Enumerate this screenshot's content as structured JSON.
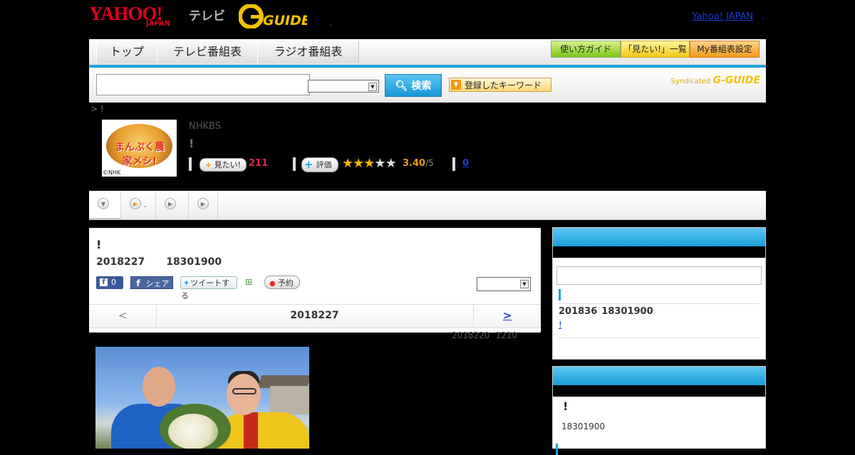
{
  "header": {
    "logo_yahoo": "YAHOO!",
    "logo_japan": "JAPAN",
    "logo_tv": "テレビ",
    "logo_gguide": "G-GUIDE",
    "separator_dot": ".",
    "yahoo_japan_link": "Yahoo! JAPAN",
    "trailing_sep": "."
  },
  "nav": {
    "tabs": [
      {
        "label": "トップ"
      },
      {
        "label": "テレビ番組表"
      },
      {
        "label": "ラジオ番組表"
      }
    ],
    "buttons": [
      {
        "label": "使い方ガイド"
      },
      {
        "label": "「見たい!」一覧"
      },
      {
        "label": "My番組表設定"
      }
    ]
  },
  "search": {
    "input_value": "",
    "select_value": "",
    "search_button": "検索",
    "keyword_button": "登録したキーワード",
    "syndicated_label": "Syndicated",
    "syndicated_logo": "G-GUIDE"
  },
  "breadcrumb": "> !",
  "program": {
    "thumb_title": "まんぷく農家メシ!",
    "thumb_credit": "©NHK",
    "channel": "NHKBS",
    "title": "!",
    "mitai_label": "見たい!",
    "mitai_count": "211",
    "hyoka_label": "評価",
    "rating_value": 3.4,
    "rating_text": "3.40",
    "rating_max": "/5",
    "stars_filled": 3,
    "stars_total": 5,
    "review_count": "0"
  },
  "tabs": [
    {
      "label": ""
    },
    {
      "label": "."
    },
    {
      "label": ""
    },
    {
      "label": ""
    }
  ],
  "main": {
    "title": "!",
    "date": "2018227",
    "time": "18301900",
    "fb_like_count": "0",
    "fb_share": "シェア",
    "tweet": "ツイートする",
    "reserve": "予約",
    "select_value": "",
    "date_prev": "<",
    "date_current": "2018227",
    "date_next": ">",
    "update_date": "2018220",
    "update_time": "1210"
  },
  "sidebar": {
    "box1": {
      "input_value": "",
      "date": "201836",
      "time": "18301900",
      "link_text": "!"
    },
    "box2": {
      "title": "!",
      "time": "18301900"
    }
  },
  "colors": {
    "accent_blue": "#1aa3dd",
    "yahoo_red": "#e0001e",
    "mitai_pink": "#e0264e",
    "rating_orange": "#e69a1a"
  }
}
